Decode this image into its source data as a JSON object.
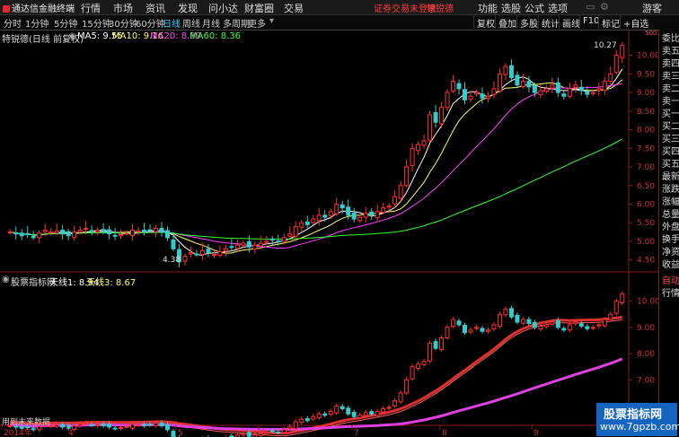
{
  "topbar": {
    "brand": "通达信金融终端",
    "menus": [
      "行情",
      "市场",
      "资讯",
      "发现",
      "问小达",
      "财富圈",
      "交易"
    ],
    "login_warning": "证券交易未登录",
    "stock": "特锐德",
    "right_menus": [
      "功能",
      "选股",
      "公式",
      "选项"
    ],
    "guest": "游客"
  },
  "periodbar": {
    "periods": [
      "分时",
      "1分钟",
      "5分钟",
      "15分钟",
      "30分钟",
      "60分钟",
      "日线",
      "周线",
      "月线",
      "多周期",
      "更多"
    ],
    "active": "日线",
    "tools": [
      "复权",
      "叠加",
      "多股",
      "统计",
      "画线",
      "F10",
      "标记",
      "+自选"
    ]
  },
  "main_chart": {
    "title": "特锐德(日线 前复权)",
    "ma": [
      {
        "label": "MA5: 9.55",
        "color": "#ffffff"
      },
      {
        "label": "MA10: 9.16",
        "color": "#ffff66"
      },
      {
        "label": "MA20: 8.89",
        "color": "#ff44ff"
      },
      {
        "label": "MA60: 8.36",
        "color": "#33ff33"
      }
    ],
    "high_label": "10.27",
    "low_label": "4.38",
    "y_ticks": [
      "10.00",
      "9.50",
      "9.00",
      "8.50",
      "8.00",
      "7.50",
      "7.00",
      "6.50",
      "6.00",
      "5.50",
      "5.00",
      "4.50"
    ],
    "unit": "500"
  },
  "sub_chart": {
    "title": "股票指标网",
    "line1": "天线1: 8.94",
    "line2": "天线3: 8.67",
    "y_ticks": [
      "10.00",
      "9.00",
      "8.00",
      "7.00",
      "6.00"
    ],
    "footnote": "用到未来数据"
  },
  "x_axis": [
    "2014年",
    "4",
    "5",
    "6",
    "7",
    "8",
    "9"
  ],
  "right_panel": {
    "items": [
      "委比",
      "卖五",
      "卖四",
      "卖三",
      "卖二",
      "卖一",
      "买一",
      "买二",
      "买三",
      "买四",
      "买五",
      "最新",
      "涨跌",
      "涨幅",
      "总量",
      "外盘",
      "换手",
      "净资",
      "收益"
    ],
    "sub_items": [
      "自动",
      "行情"
    ]
  },
  "watermark": {
    "line1": "股票指标网",
    "line2": "www.7gpzb.com"
  },
  "chart_data": {
    "type": "candlestick",
    "title": "特锐德(日线 前复权)",
    "ylim": [
      4.3,
      10.4
    ],
    "x_labels": [
      "2014年",
      "4",
      "5",
      "6",
      "7",
      "8",
      "9"
    ],
    "close": [
      5.25,
      5.2,
      5.15,
      5.18,
      5.1,
      5.22,
      5.3,
      5.25,
      5.28,
      5.2,
      5.15,
      5.25,
      5.3,
      5.35,
      5.28,
      5.3,
      5.25,
      5.2,
      5.15,
      5.18,
      5.22,
      5.3,
      5.28,
      5.25,
      5.3,
      5.35,
      5.25,
      5.1,
      4.8,
      4.45,
      4.6,
      4.7,
      4.65,
      4.75,
      4.7,
      4.65,
      4.72,
      4.8,
      4.85,
      4.9,
      4.95,
      4.85,
      4.9,
      4.95,
      5.0,
      5.05,
      5.0,
      5.1,
      5.2,
      5.4,
      5.5,
      5.45,
      5.6,
      5.7,
      5.65,
      5.8,
      6.0,
      5.9,
      5.7,
      5.6,
      5.65,
      5.75,
      5.7,
      5.8,
      5.9,
      5.95,
      6.2,
      6.5,
      7.0,
      7.5,
      7.6,
      7.7,
      8.4,
      8.2,
      8.6,
      9.0,
      9.3,
      9.1,
      8.8,
      8.9,
      9.0,
      8.85,
      8.9,
      9.1,
      9.5,
      9.7,
      9.4,
      9.2,
      9.3,
      9.15,
      9.0,
      9.05,
      9.1,
      9.2,
      9.0,
      8.9,
      9.1,
      9.2,
      9.05,
      8.95,
      9.0,
      9.1,
      9.3,
      9.5,
      10.0,
      10.27
    ],
    "series": [
      {
        "name": "MA5",
        "last": 9.55
      },
      {
        "name": "MA10",
        "last": 9.16
      },
      {
        "name": "MA20",
        "last": 8.89
      },
      {
        "name": "MA60",
        "last": 8.36
      }
    ]
  }
}
